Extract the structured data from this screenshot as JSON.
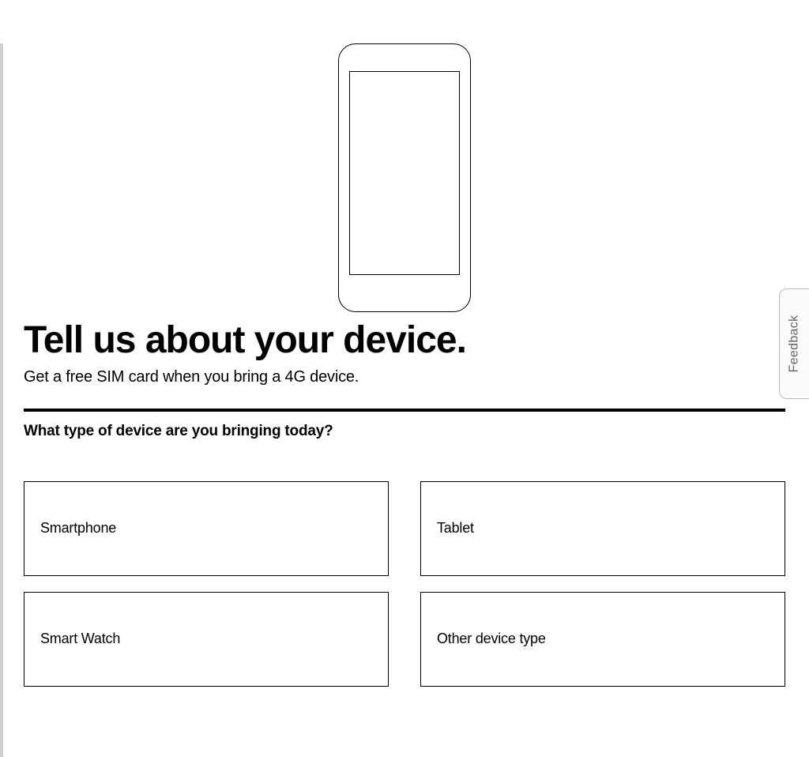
{
  "heading": "Tell us about your device.",
  "subheading": "Get a free SIM card when you bring a 4G device.",
  "question": "What type of device are you bringing today?",
  "options": [
    {
      "label": "Smartphone"
    },
    {
      "label": "Tablet"
    },
    {
      "label": "Smart Watch"
    },
    {
      "label": "Other device type"
    }
  ],
  "feedback": {
    "label": "Feedback"
  }
}
